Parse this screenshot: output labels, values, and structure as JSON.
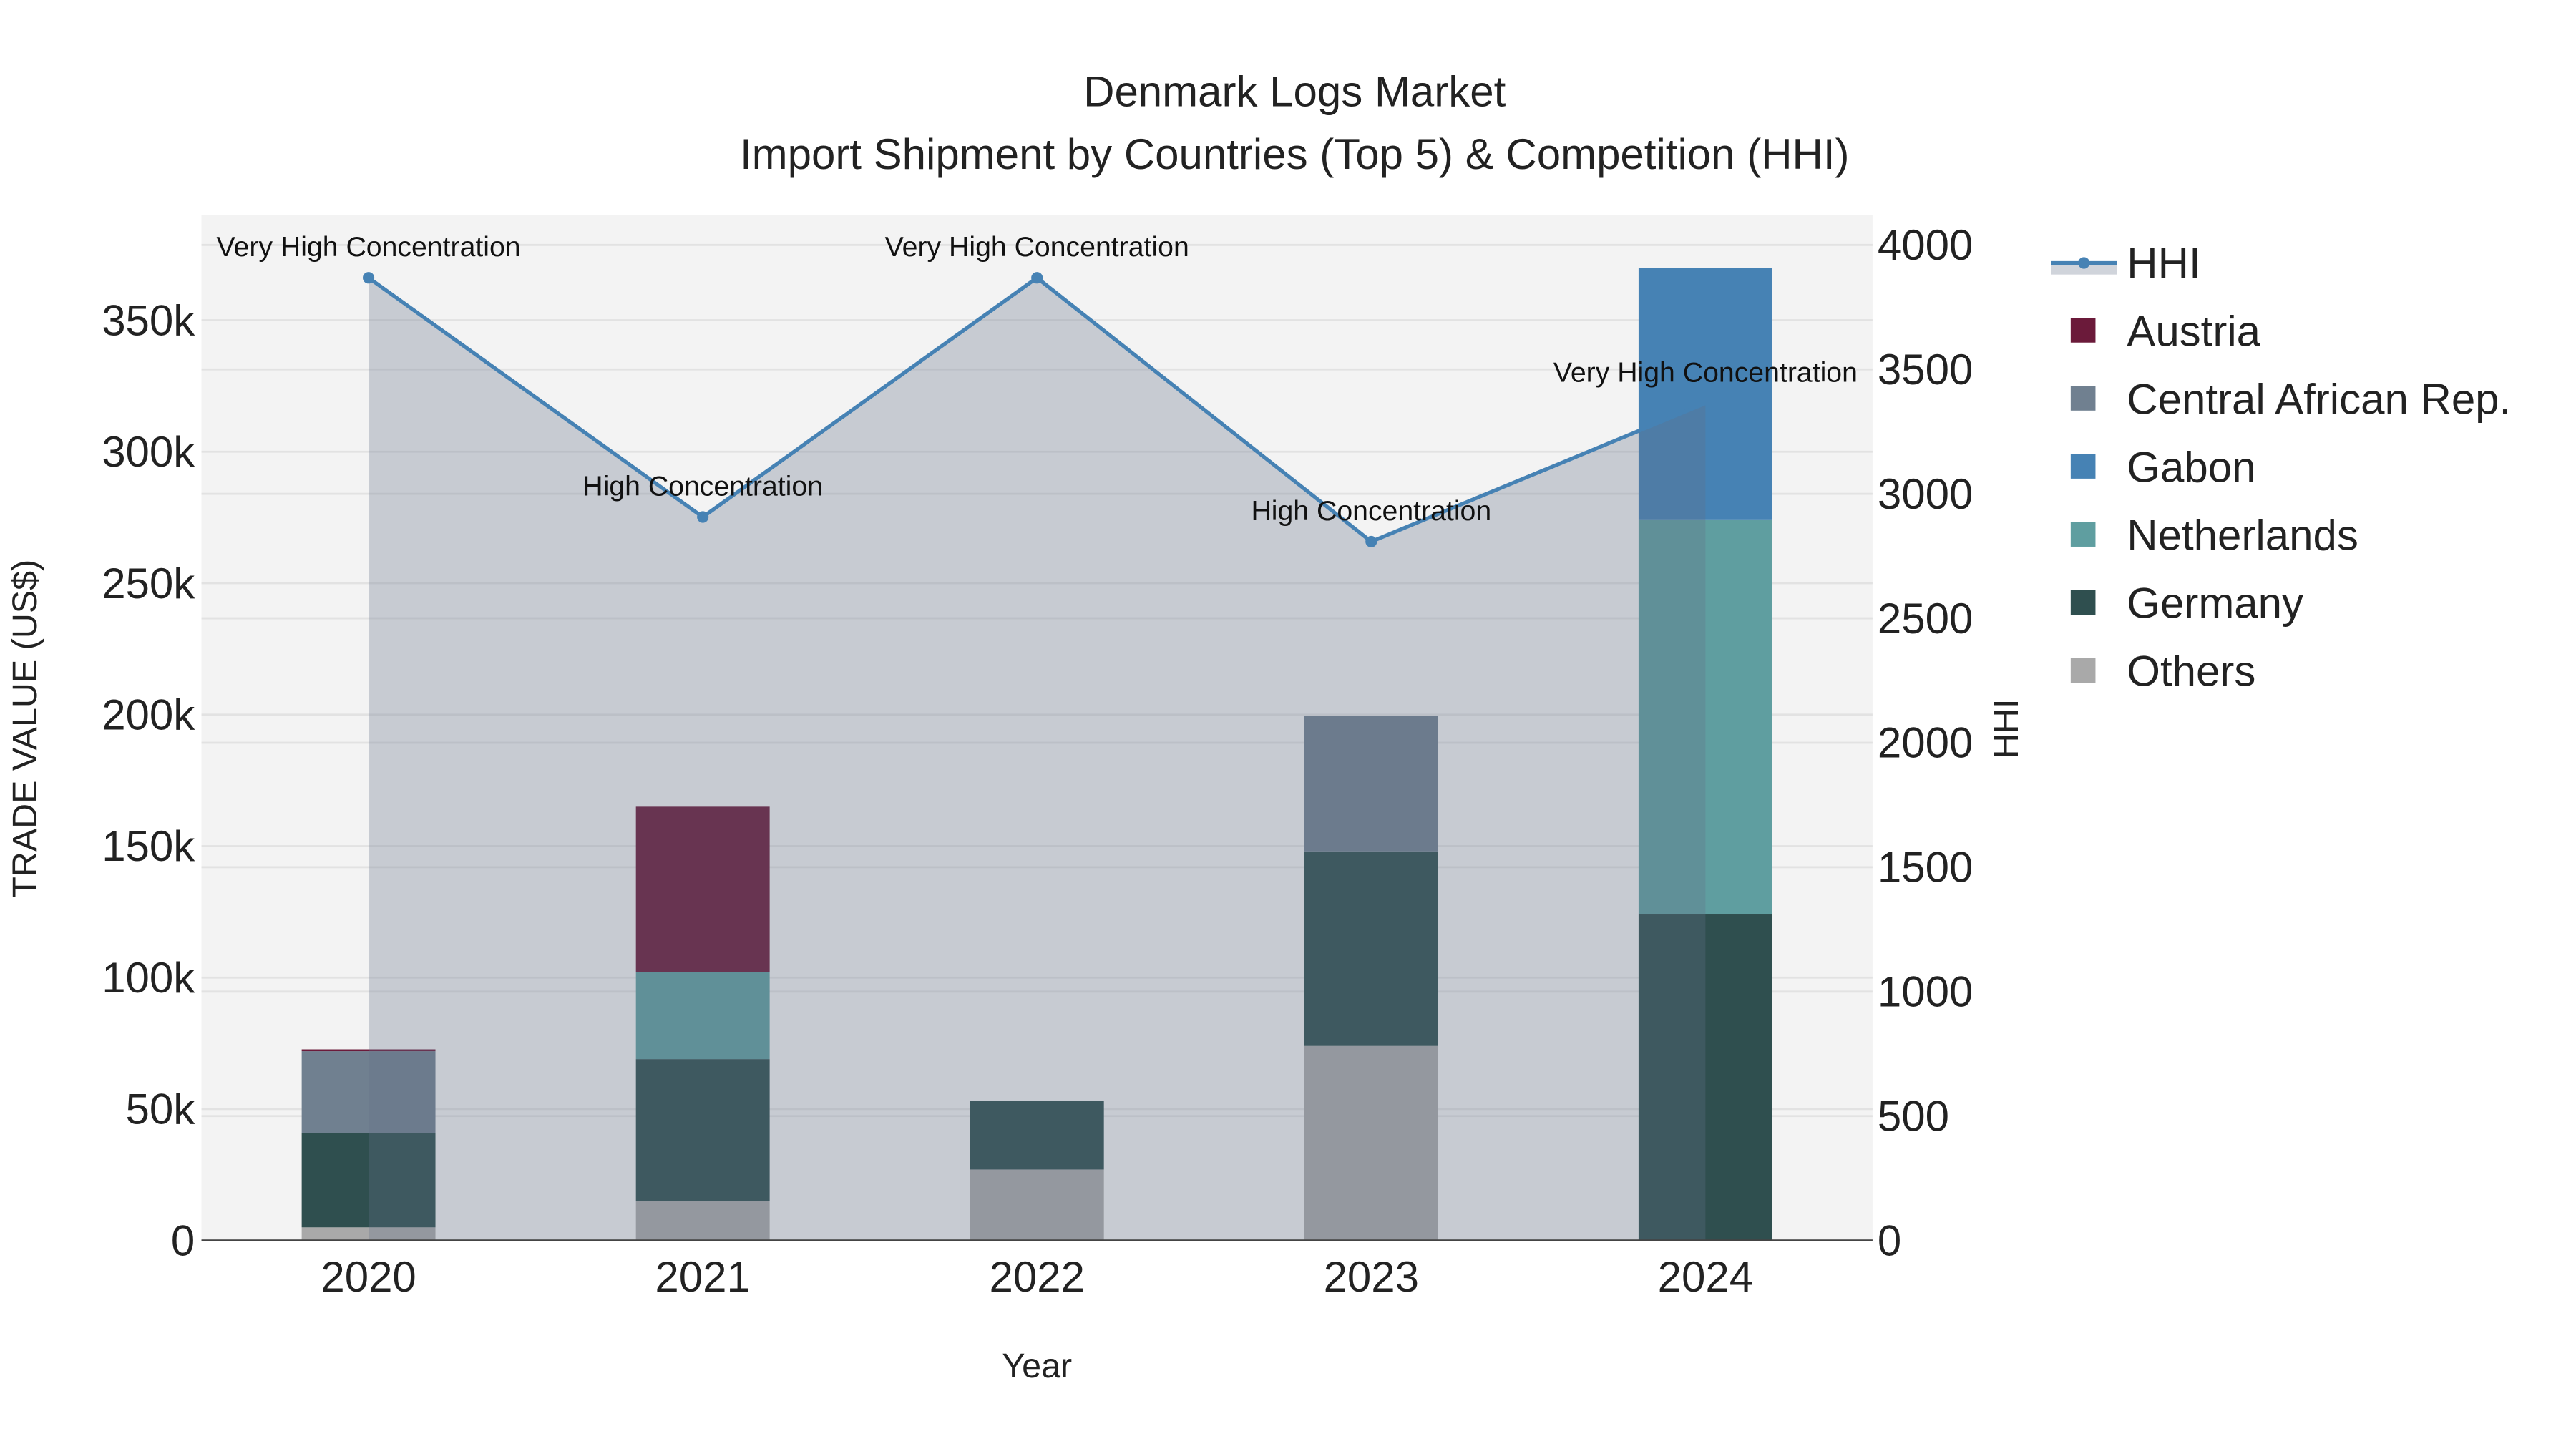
{
  "chart_data": {
    "type": "bar",
    "title": "Denmark Logs Market",
    "subtitle": "Import Shipment by Countries (Top 5) & Competition (HHI)",
    "xlabel": "Year",
    "ylabel": "TRADE VALUE (US$)",
    "y2label": "HHI",
    "categories": [
      "2020",
      "2021",
      "2022",
      "2023",
      "2024"
    ],
    "ylim": [
      0,
      390000
    ],
    "y2lim": [
      0,
      4120
    ],
    "yticks": [
      0,
      50000,
      100000,
      150000,
      200000,
      250000,
      300000,
      350000
    ],
    "yticklabels": [
      "0",
      "50k",
      "100k",
      "150k",
      "200k",
      "250k",
      "300k",
      "350k"
    ],
    "y2ticks": [
      0,
      500,
      1000,
      1500,
      2000,
      2500,
      3000,
      3500,
      4000
    ],
    "y2ticklabels": [
      "0",
      "500",
      "1000",
      "1500",
      "2000",
      "2500",
      "3000",
      "3500",
      "4000"
    ],
    "grid": true,
    "legend_position": "right",
    "series": [
      {
        "name": "Others",
        "color": "#a9a9a9",
        "values": [
          5000,
          15000,
          27000,
          74000,
          0
        ]
      },
      {
        "name": "Germany",
        "color": "#2f4f4f",
        "values": [
          36000,
          54000,
          26000,
          74000,
          124000
        ]
      },
      {
        "name": "Netherlands",
        "color": "#5f9ea0",
        "values": [
          0,
          33000,
          0,
          0,
          150000
        ]
      },
      {
        "name": "Gabon",
        "color": "#4682b4",
        "values": [
          0,
          0,
          0,
          0,
          96000
        ]
      },
      {
        "name": "Central African Rep.",
        "color": "#708090",
        "values": [
          31000,
          0,
          0,
          51500,
          0
        ]
      },
      {
        "name": "Austria",
        "color": "#6b1a3a",
        "values": [
          700,
          63000,
          0,
          0,
          0
        ]
      }
    ],
    "legend_order": [
      "HHI",
      "Austria",
      "Central African Rep.",
      "Gabon",
      "Netherlands",
      "Germany",
      "Others"
    ],
    "hhi": {
      "name": "HHI",
      "color": "#4682b4",
      "values": [
        3868,
        2907,
        3868,
        2808,
        3364
      ],
      "annotations": [
        "Very High Concentration",
        "High Concentration",
        "Very High Concentration",
        "High Concentration",
        "Very High Concentration"
      ]
    }
  }
}
